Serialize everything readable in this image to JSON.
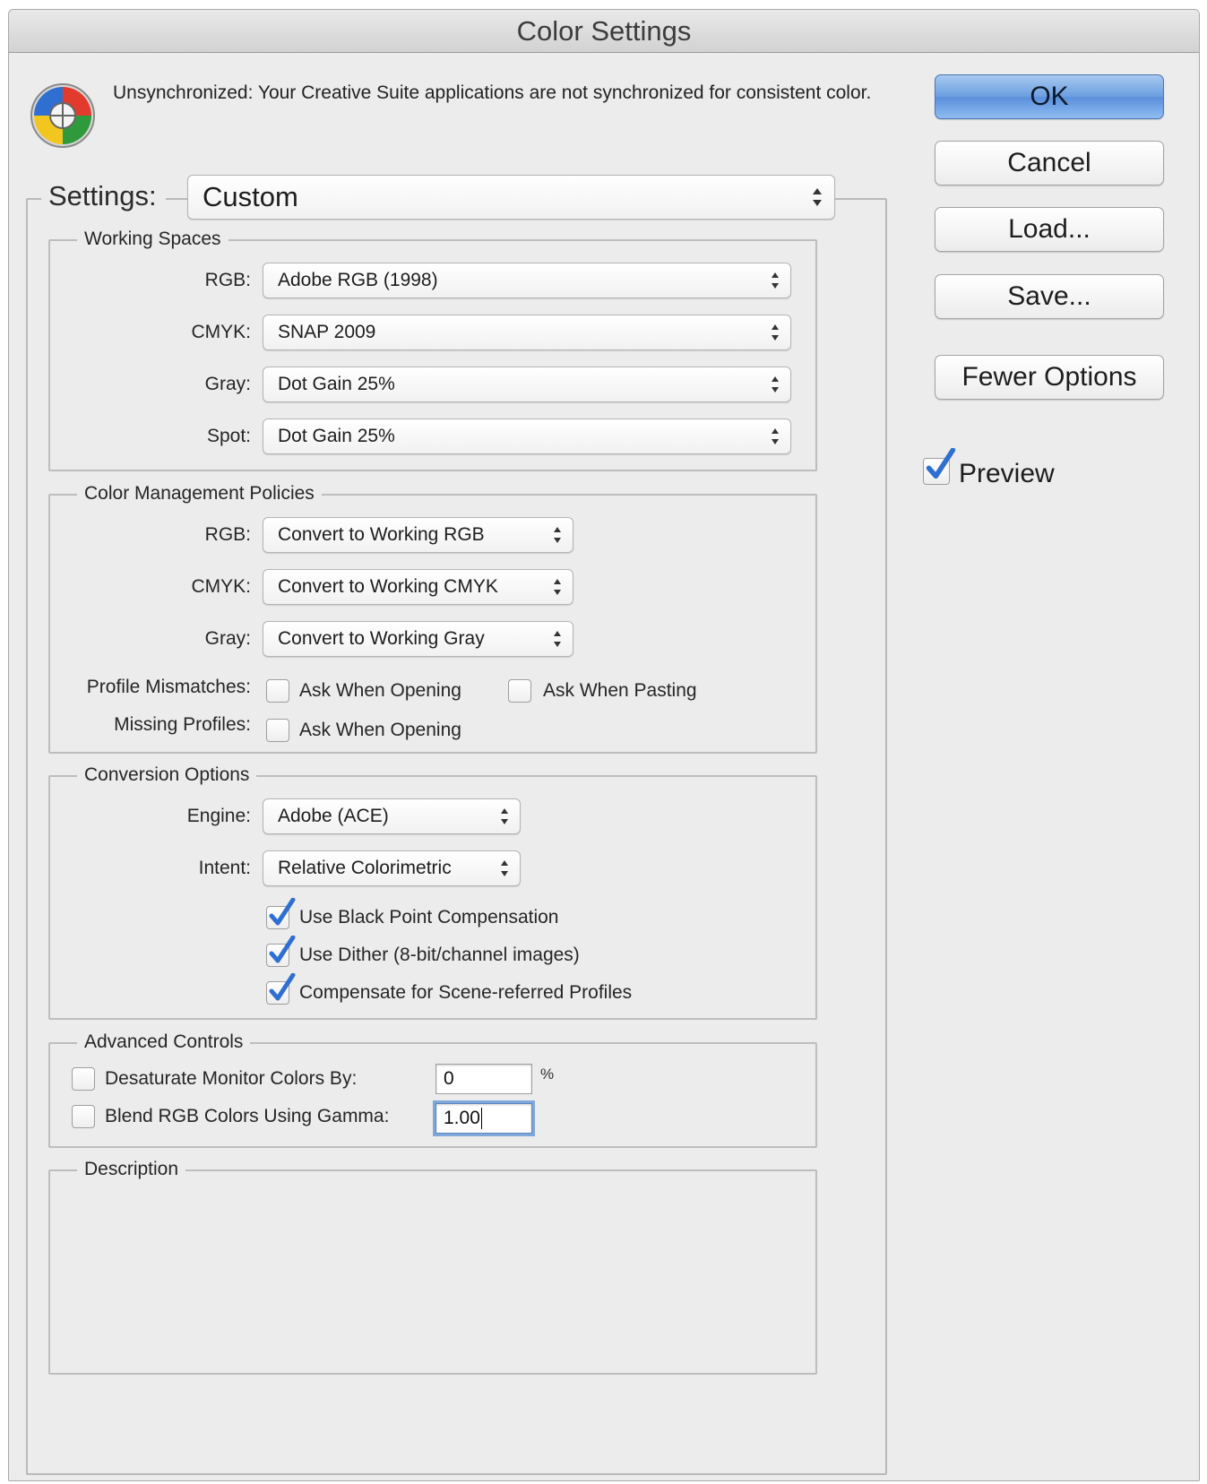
{
  "window": {
    "title": "Color Settings"
  },
  "sync_message": "Unsynchronized: Your Creative Suite applications are not synchronized for consistent color.",
  "settings": {
    "label": "Settings:",
    "value": "Custom"
  },
  "working_spaces": {
    "title": "Working Spaces",
    "rgb": {
      "label": "RGB:",
      "value": "Adobe RGB (1998)"
    },
    "cmyk": {
      "label": "CMYK:",
      "value": "SNAP 2009"
    },
    "gray": {
      "label": "Gray:",
      "value": "Dot Gain 25%"
    },
    "spot": {
      "label": "Spot:",
      "value": "Dot Gain 25%"
    }
  },
  "policies": {
    "title": "Color Management Policies",
    "rgb": {
      "label": "RGB:",
      "value": "Convert to Working RGB"
    },
    "cmyk": {
      "label": "CMYK:",
      "value": "Convert to Working CMYK"
    },
    "gray": {
      "label": "Gray:",
      "value": "Convert to Working Gray"
    },
    "profile_mismatches": {
      "label": "Profile Mismatches:",
      "ask_opening": {
        "label": "Ask When Opening",
        "checked": false
      },
      "ask_pasting": {
        "label": "Ask When Pasting",
        "checked": false
      }
    },
    "missing_profiles": {
      "label": "Missing Profiles:",
      "ask_opening": {
        "label": "Ask When Opening",
        "checked": false
      }
    }
  },
  "conversion": {
    "title": "Conversion Options",
    "engine": {
      "label": "Engine:",
      "value": "Adobe (ACE)"
    },
    "intent": {
      "label": "Intent:",
      "value": "Relative Colorimetric"
    },
    "black_point": {
      "label": "Use Black Point Compensation",
      "checked": true
    },
    "dither": {
      "label": "Use Dither (8-bit/channel images)",
      "checked": true
    },
    "scene_referred": {
      "label": "Compensate for Scene-referred Profiles",
      "checked": true
    }
  },
  "advanced": {
    "title": "Advanced Controls",
    "desaturate": {
      "label": "Desaturate Monitor Colors By:",
      "checked": false,
      "value": "0",
      "unit": "%"
    },
    "blend": {
      "label": "Blend RGB Colors Using Gamma:",
      "checked": false,
      "value": "1.00"
    }
  },
  "description": {
    "title": "Description",
    "text": ""
  },
  "buttons": {
    "ok": "OK",
    "cancel": "Cancel",
    "load": "Load...",
    "save": "Save...",
    "fewer_options": "Fewer Options"
  },
  "preview": {
    "label": "Preview",
    "checked": true
  },
  "icons": {
    "logo": "color-settings-wheel-icon",
    "popup_arrows": "up-down-arrows-icon",
    "check": "checkmark-icon"
  },
  "colors": {
    "window_bg": "#ececec",
    "default_button": "#6b9ee0",
    "check_blue": "#2f6fd1",
    "focus_ring": "#7fa7da"
  }
}
